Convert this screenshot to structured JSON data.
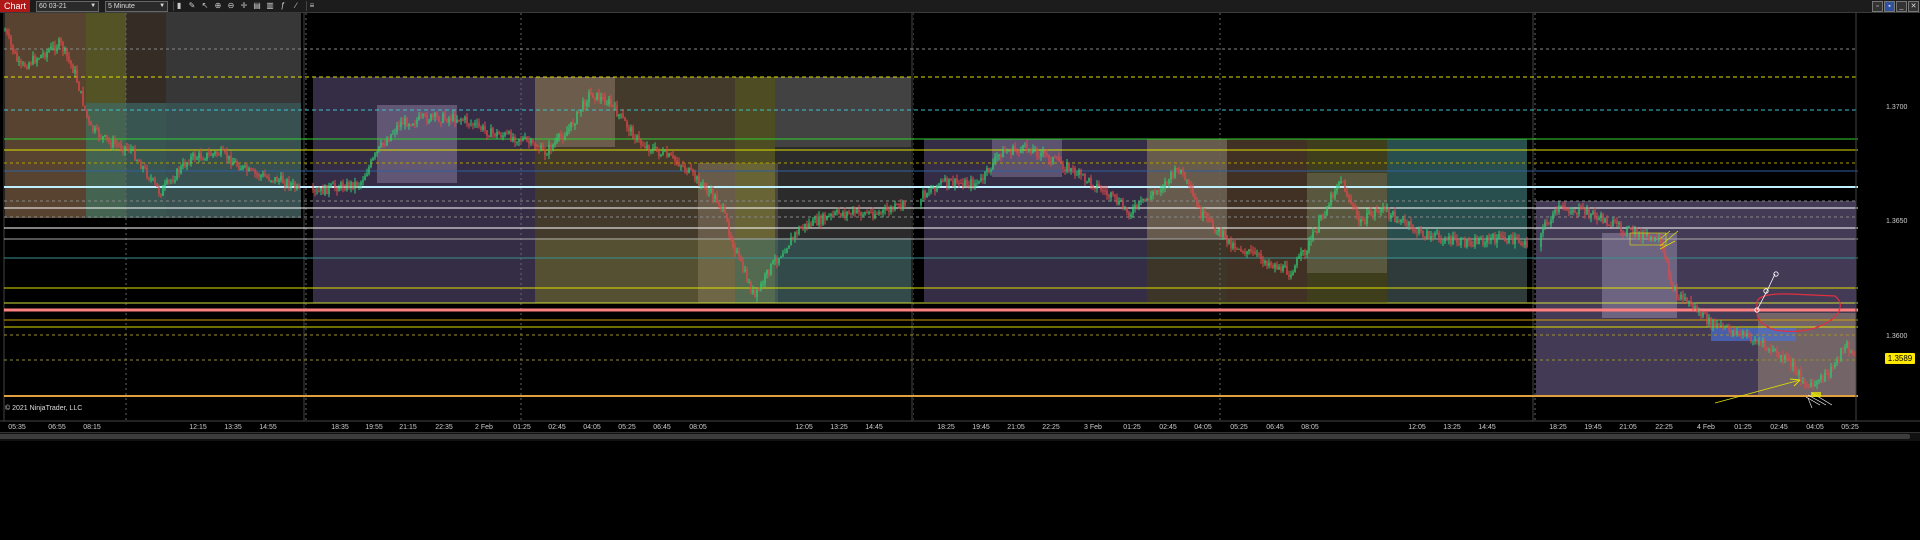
{
  "app": {
    "title": "Chart"
  },
  "toolbar": {
    "instrument": "60 03-21",
    "interval": "5 Minute",
    "tools": [
      "bar-chart-icon",
      "pencil-icon",
      "cursor-icon",
      "zoom-icon",
      "zoom-out-icon",
      "crosshair-icon",
      "properties-icon",
      "strategies-icon",
      "indicators-icon",
      "drawing-tools-icon",
      "data-box-icon"
    ]
  },
  "window_controls": [
    "restore-icon",
    "tile-icon",
    "minimize-icon",
    "close-icon"
  ],
  "copyright": "© 2021 NinjaTrader, LLC",
  "current_price": "1.3589",
  "price_axis": [
    "1.3700",
    "1.3650",
    "1.3600"
  ],
  "time_axis": [
    "05:35",
    "06:55",
    "08:15",
    "12:15",
    "13:35",
    "14:55",
    "18:35",
    "19:55",
    "21:15",
    "22:35",
    "2 Feb",
    "01:25",
    "02:45",
    "04:05",
    "05:25",
    "06:45",
    "08:05",
    "12:05",
    "13:25",
    "14:45",
    "18:25",
    "19:45",
    "21:05",
    "22:25",
    "3 Feb",
    "01:25",
    "02:45",
    "04:05",
    "05:25",
    "06:45",
    "08:05",
    "12:05",
    "13:25",
    "14:45",
    "18:25",
    "19:45",
    "21:05",
    "22:25",
    "4 Feb",
    "01:25",
    "02:45",
    "04:05",
    "05:25"
  ],
  "colors": {
    "background": "#000000",
    "up_candle": "#2ecc71",
    "down_candle": "#e04848",
    "current_price_bg": "#ffe800",
    "title_bg": "#b01818"
  }
}
